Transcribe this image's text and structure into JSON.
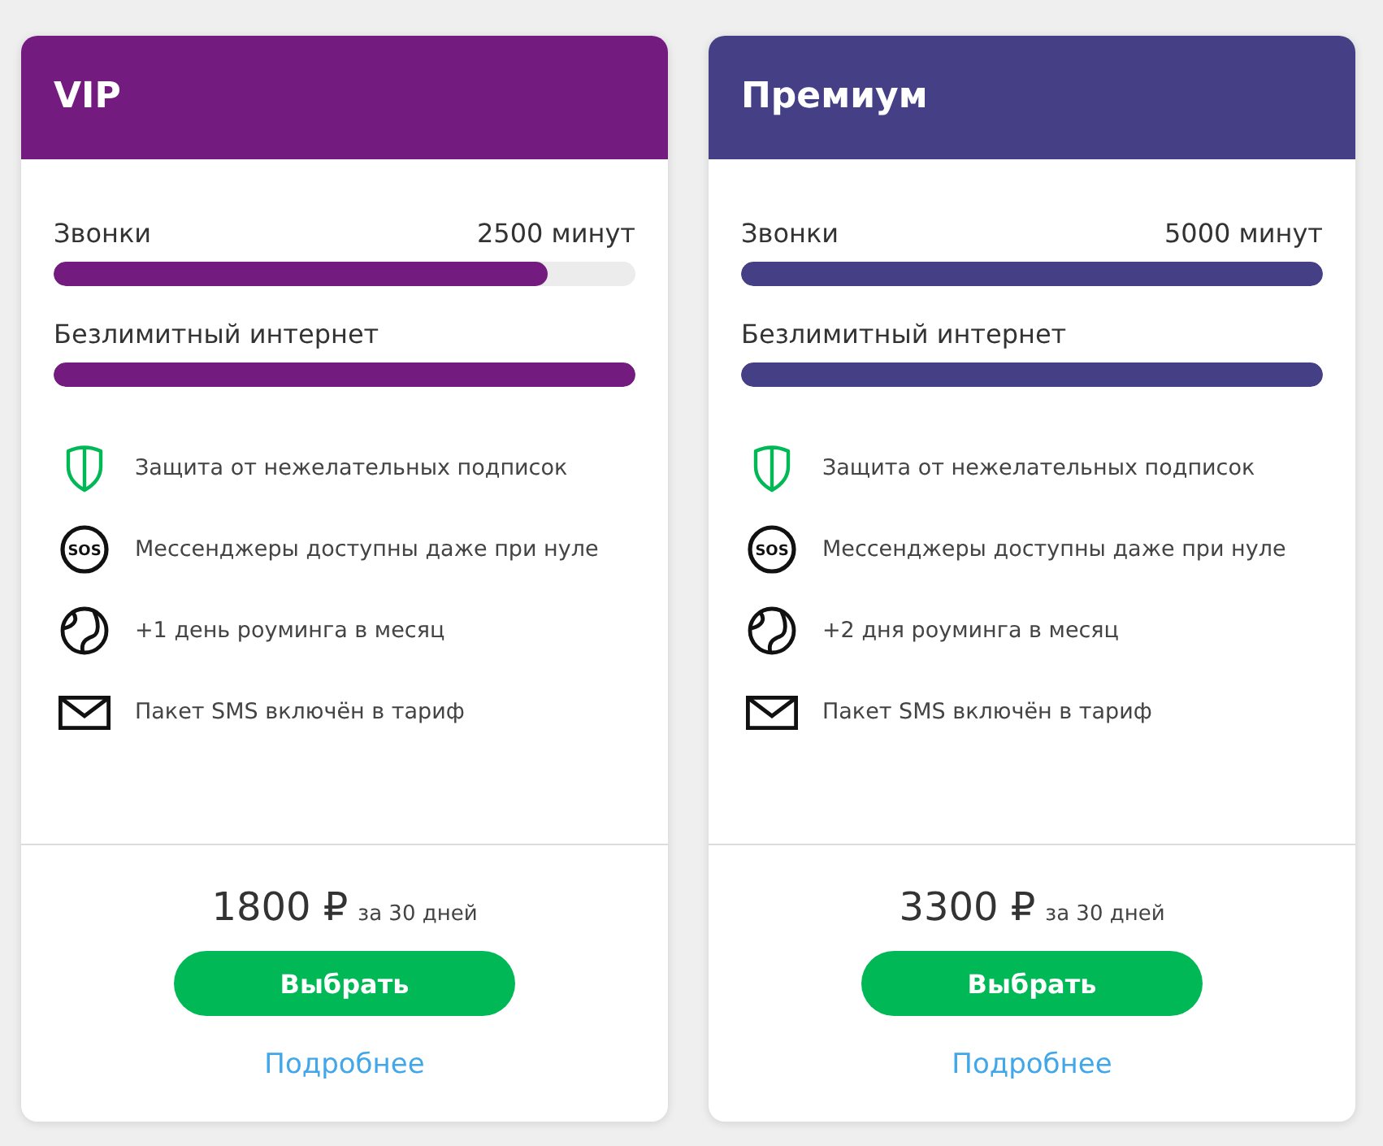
{
  "plans": [
    {
      "name": "VIP",
      "color": "#741b7f",
      "allowances": [
        {
          "label": "Звонки",
          "value": "2500 минут",
          "level": 0.85
        },
        {
          "label": "Безлимитный интернет",
          "level": 1
        }
      ],
      "features": [
        {
          "kind": "shield",
          "text": "Защита от нежелательных подписок"
        },
        {
          "kind": "sos",
          "icon_text": "SOS",
          "text": "Мессенджеры доступны даже при нуле"
        },
        {
          "kind": "globe",
          "text": "+1 день роуминга в месяц"
        },
        {
          "kind": "envelope",
          "text": "Пакет SMS включён в тариф"
        }
      ],
      "price": {
        "amount": "1800 ₽",
        "period": "за 30 дней"
      },
      "button": "Выбрать",
      "link": "Подробнее"
    },
    {
      "name": "Премиум",
      "color": "#453f86",
      "allowances": [
        {
          "label": "Звонки",
          "value": "5000 минут",
          "level": 1
        },
        {
          "label": "Безлимитный интернет",
          "level": 1
        }
      ],
      "features": [
        {
          "kind": "shield",
          "text": "Защита от нежелательных подписок"
        },
        {
          "kind": "sos",
          "icon_text": "SOS",
          "text": "Мессенджеры доступны даже при нуле"
        },
        {
          "kind": "globe",
          "text": "+2 дня роуминга в месяц"
        },
        {
          "kind": "envelope",
          "text": "Пакет SMS включён в тариф"
        }
      ],
      "price": {
        "amount": "3300 ₽",
        "period": "за 30 дней"
      },
      "button": "Выбрать",
      "link": "Подробнее"
    }
  ]
}
